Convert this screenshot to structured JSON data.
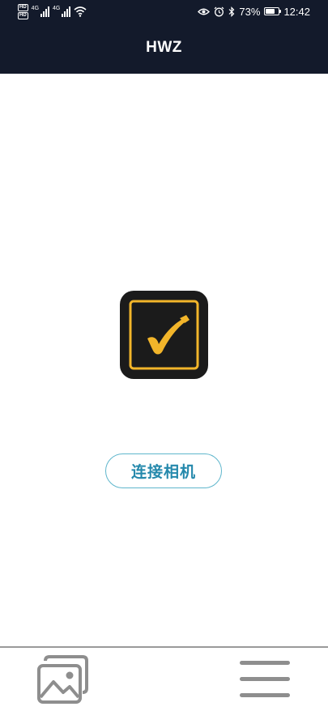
{
  "status_bar": {
    "left_badges": [
      "HD",
      "HD"
    ],
    "network_labels": [
      "4G",
      "4G"
    ],
    "battery_percent": "73%",
    "battery_level": 0.73,
    "time": "12:42",
    "icons": [
      "eye-icon",
      "alarm-icon",
      "bluetooth-icon",
      "battery-icon",
      "wifi-icon",
      "signal-icon"
    ]
  },
  "header": {
    "title": "HWZ",
    "background_color": "#131a2b"
  },
  "main": {
    "app_icon": "camera-app-checkmark-icon",
    "connect_button_label": "连接相机",
    "accent_color": "#2589ac"
  },
  "bottom_nav": {
    "items": [
      "gallery-icon",
      "menu-icon"
    ]
  }
}
